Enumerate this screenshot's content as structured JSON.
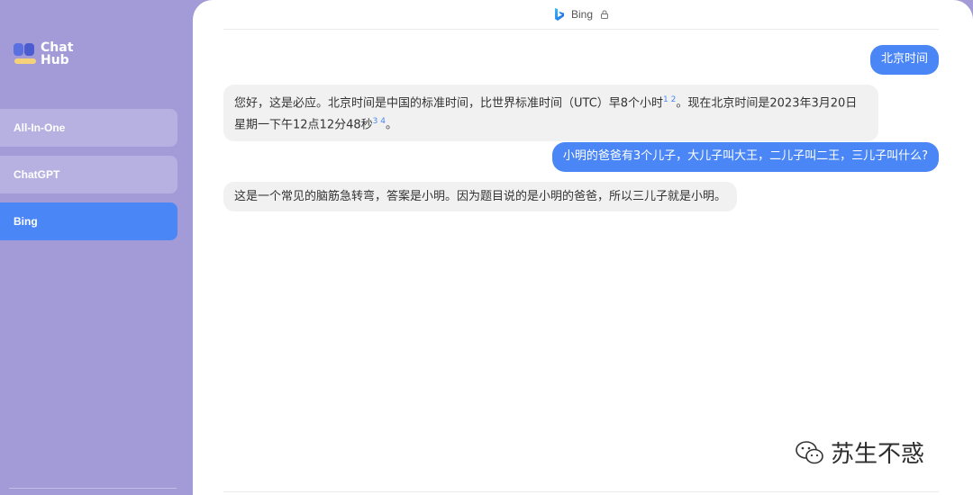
{
  "app": {
    "logo_line1": "Chat",
    "logo_line2": "Hub"
  },
  "sidebar": {
    "items": [
      {
        "label": "All-In-One",
        "active": false
      },
      {
        "label": "ChatGPT",
        "active": false
      },
      {
        "label": "Bing",
        "active": true
      }
    ]
  },
  "header": {
    "title": "Bing",
    "icon": "bing-icon",
    "badge_icon": "lock-icon"
  },
  "messages": [
    {
      "role": "user",
      "text": "北京时间"
    },
    {
      "role": "bot",
      "text_a": "您好，这是必应。北京时间是中国的标准时间，比世界标准时间（UTC）早8个小时",
      "ref_a": "1 2",
      "text_b": "。现在北京时间是2023年3月20日星期一下午12点12分48秒",
      "ref_b": "3 4",
      "text_c": "。"
    },
    {
      "role": "user",
      "text": "小明的爸爸有3个儿子，大儿子叫大王，二儿子叫二王，三儿子叫什么?"
    },
    {
      "role": "bot",
      "text": "这是一个常见的脑筋急转弯，答案是小明。因为题目说的是小明的爸爸，所以三儿子就是小明。"
    }
  ],
  "watermark": {
    "text": "苏生不惑",
    "icon": "wechat-icon"
  },
  "colors": {
    "sidebar_bg": "#a29bd8",
    "accent": "#4a86f5",
    "bot_bubble": "#f1f1f1"
  }
}
